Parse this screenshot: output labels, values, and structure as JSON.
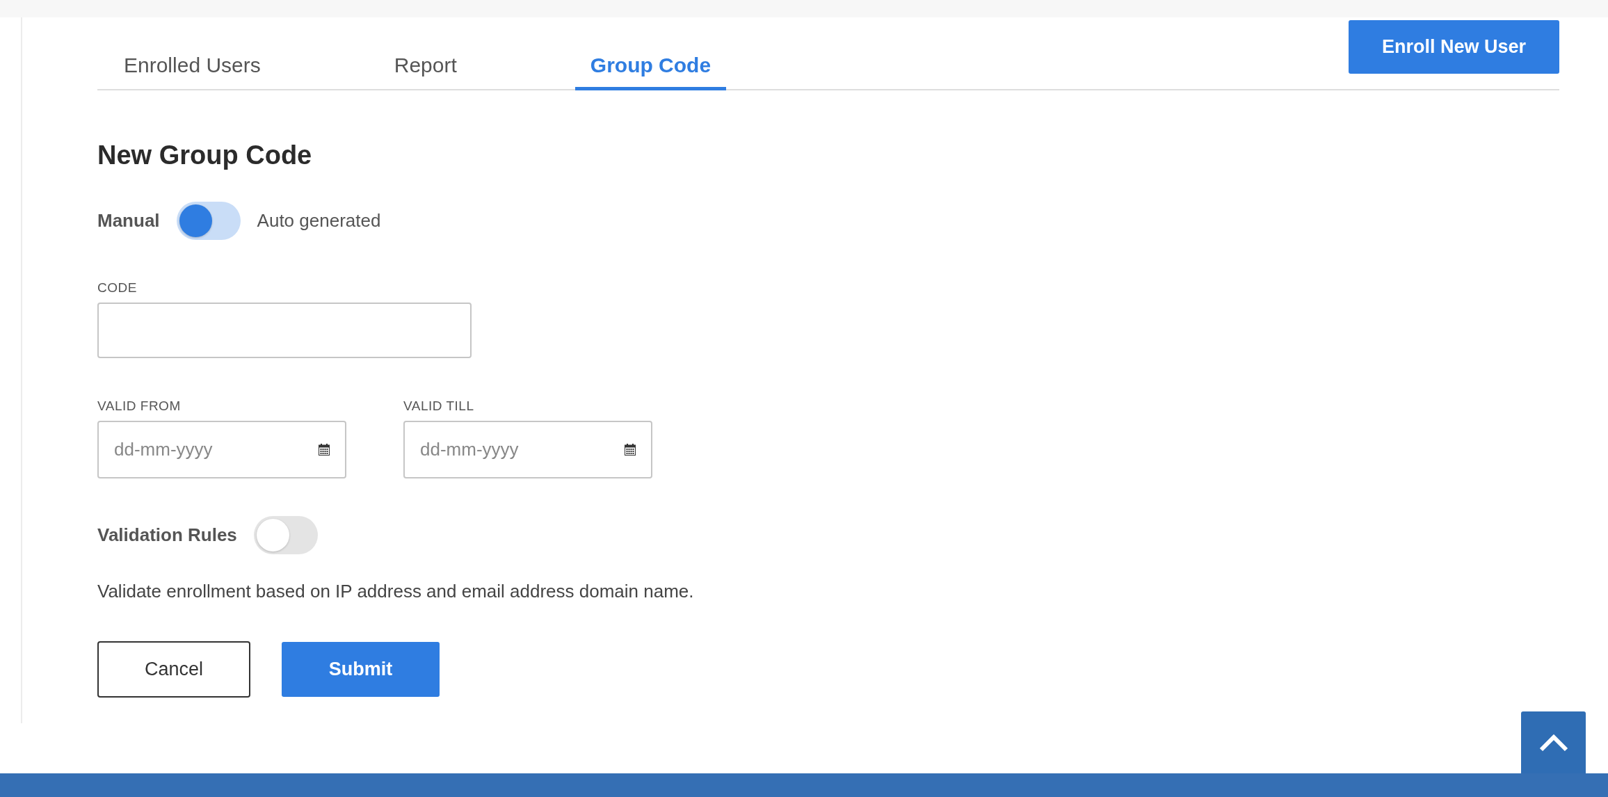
{
  "tabs": [
    {
      "label": "Enrolled Users",
      "selected": false
    },
    {
      "label": "Report",
      "selected": false
    },
    {
      "label": "Group Code",
      "selected": true
    }
  ],
  "enroll_button": "Enroll New User",
  "form": {
    "title": "New Group Code",
    "mode_switch": {
      "left_label": "Manual",
      "right_label": "Auto generated",
      "auto_generated": false
    },
    "code_field": {
      "label": "CODE"
    },
    "date_fields": [
      {
        "label": "VALID FROM",
        "placeholder": "dd-mm-yyyy"
      },
      {
        "label": "VALID TILL",
        "placeholder": "dd-mm-yyyy"
      }
    ],
    "validation_rules": {
      "label": "Validation Rules",
      "on": false,
      "description": "Validate enrollment based on IP address and email address domain name."
    },
    "buttons": {
      "cancel": "Cancel",
      "submit": "Submit"
    }
  }
}
